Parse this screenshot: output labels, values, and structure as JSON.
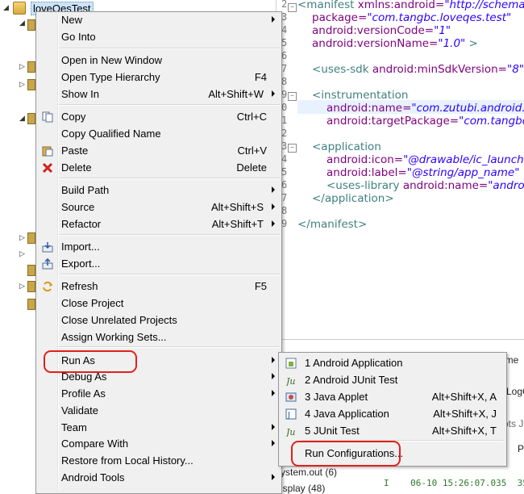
{
  "project": {
    "name": "loveQesTest"
  },
  "context_menu": {
    "items": [
      {
        "label": "New",
        "shortcut": "",
        "submenu": true,
        "icon": ""
      },
      {
        "label": "Go Into",
        "shortcut": "",
        "submenu": false,
        "icon": ""
      },
      {
        "label": "Open in New Window",
        "shortcut": "",
        "submenu": false,
        "icon": ""
      },
      {
        "label": "Open Type Hierarchy",
        "shortcut": "F4",
        "submenu": false,
        "icon": ""
      },
      {
        "label": "Show In",
        "shortcut": "Alt+Shift+W",
        "submenu": true,
        "icon": ""
      },
      {
        "label": "Copy",
        "shortcut": "Ctrl+C",
        "submenu": false,
        "icon": "copy-icon"
      },
      {
        "label": "Copy Qualified Name",
        "shortcut": "",
        "submenu": false,
        "icon": ""
      },
      {
        "label": "Paste",
        "shortcut": "Ctrl+V",
        "submenu": false,
        "icon": "paste-icon"
      },
      {
        "label": "Delete",
        "shortcut": "Delete",
        "submenu": false,
        "icon": "delete-icon"
      },
      {
        "label": "Build Path",
        "shortcut": "",
        "submenu": true,
        "icon": ""
      },
      {
        "label": "Source",
        "shortcut": "Alt+Shift+S",
        "submenu": true,
        "icon": ""
      },
      {
        "label": "Refactor",
        "shortcut": "Alt+Shift+T",
        "submenu": true,
        "icon": ""
      },
      {
        "label": "Import...",
        "shortcut": "",
        "submenu": false,
        "icon": "import-icon"
      },
      {
        "label": "Export...",
        "shortcut": "",
        "submenu": false,
        "icon": "export-icon"
      },
      {
        "label": "Refresh",
        "shortcut": "F5",
        "submenu": false,
        "icon": "refresh-icon"
      },
      {
        "label": "Close Project",
        "shortcut": "",
        "submenu": false,
        "icon": ""
      },
      {
        "label": "Close Unrelated Projects",
        "shortcut": "",
        "submenu": false,
        "icon": ""
      },
      {
        "label": "Assign Working Sets...",
        "shortcut": "",
        "submenu": false,
        "icon": ""
      },
      {
        "label": "Run As",
        "shortcut": "",
        "submenu": true,
        "icon": ""
      },
      {
        "label": "Debug As",
        "shortcut": "",
        "submenu": true,
        "icon": ""
      },
      {
        "label": "Profile As",
        "shortcut": "",
        "submenu": true,
        "icon": ""
      },
      {
        "label": "Validate",
        "shortcut": "",
        "submenu": false,
        "icon": ""
      },
      {
        "label": "Team",
        "shortcut": "",
        "submenu": true,
        "icon": ""
      },
      {
        "label": "Compare With",
        "shortcut": "",
        "submenu": true,
        "icon": ""
      },
      {
        "label": "Restore from Local History...",
        "shortcut": "",
        "submenu": false,
        "icon": ""
      },
      {
        "label": "Android Tools",
        "shortcut": "",
        "submenu": true,
        "icon": ""
      }
    ]
  },
  "run_as_submenu": {
    "items": [
      {
        "label": "1 Android Application",
        "shortcut": "",
        "icon": "android-app-icon"
      },
      {
        "label": "2 Android JUnit Test",
        "shortcut": "",
        "icon": "junit-icon"
      },
      {
        "label": "3 Java Applet",
        "shortcut": "Alt+Shift+X, A",
        "icon": "applet-icon"
      },
      {
        "label": "4 Java Application",
        "shortcut": "Alt+Shift+X, J",
        "icon": "java-app-icon"
      },
      {
        "label": "5 JUnit Test",
        "shortcut": "Alt+Shift+X, T",
        "icon": "junit-icon"
      },
      {
        "label": "Run Configurations...",
        "shortcut": "",
        "icon": ""
      }
    ]
  },
  "editor": {
    "line_numbers": [
      "2",
      "3",
      "4",
      "5",
      "6",
      "7",
      "8",
      "9",
      "0",
      "1",
      "2",
      "3",
      "4",
      "5",
      "6",
      "7",
      "8",
      "9"
    ],
    "lines": {
      "l1_tag": "<manifest",
      "l1_attr": " xmlns:android=",
      "l1_val": "\"http://schemas",
      "l2_attr": "package=",
      "l2_val": "\"com.tangbc.loveqes.test\"",
      "l3_attr": "android:versionCode=",
      "l3_val": "\"1\"",
      "l4_attr": "android:versionName=",
      "l4_val": "\"1.0\"",
      "l4_tag": " >",
      "l6_tag": "<uses-sdk",
      "l6_attr": " android:minSdkVersion=",
      "l6_val": "\"8\"",
      "l8_tag": "<instrumentation",
      "l9_attr": "android:name=",
      "l9_val": "\"com.zutubi.android.j",
      "l10_attr": "android:targetPackage=",
      "l10_val": "\"com.tangbc",
      "l12_tag": "<application",
      "l13_attr": "android:icon=",
      "l13_val": "\"@drawable/ic_launche",
      "l14_attr": "android:label=",
      "l14_val": "\"@string/app_name\"",
      "l14_tag": " >",
      "l15_tag": "<uses-library",
      "l15_attr": " android:name=",
      "l15_val": "\"androi",
      "l16_tag": "</application>",
      "l18_tag": "</manifest>"
    }
  },
  "bottom": {
    "tab_fragment": "ume",
    "logcat_fragment": "LogC",
    "shots_fragment": "ots Ja",
    "col_fragment": "P",
    "system_out": "ystem.out (6)",
    "display": "isplay (48)",
    "log_level": "I",
    "log_time": "06-10 15:26:07.035",
    "log_pid": "356"
  },
  "colors": {
    "annotation_red": "#e0201b",
    "selection": "#cde3f7",
    "menu_bg": "#f0f0f0"
  }
}
